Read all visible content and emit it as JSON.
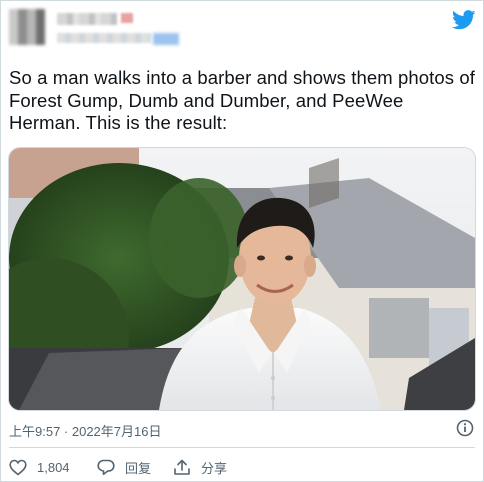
{
  "tweet": {
    "text": "So a man walks into a barber and shows them photos of Forest Gump, Dumb and Dumber, and PeeWee Herman. This is the result:",
    "timestamp": "上午9:57 · 2022年7月16日"
  },
  "actions": {
    "like_count": "1,804",
    "reply_label": "回复",
    "share_label": "分享"
  },
  "icons": {
    "brand": "twitter-bird-icon",
    "info": "info-icon",
    "like": "heart-icon",
    "reply": "speech-bubble-icon",
    "share": "share-upload-icon"
  },
  "colors": {
    "twitter_blue": "#1d9bf0",
    "text": "#0f1419",
    "muted": "#536471",
    "border": "#cfd9de"
  }
}
